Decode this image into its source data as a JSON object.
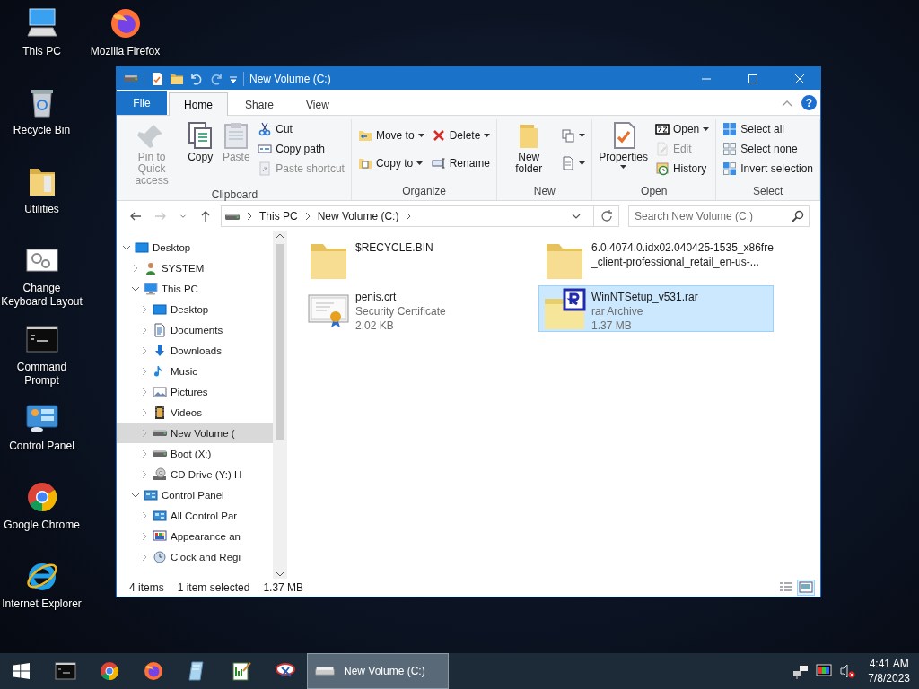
{
  "desktop_icons": [
    {
      "label": "This PC",
      "kind": "pc"
    },
    {
      "label": "Recycle Bin",
      "kind": "recycle"
    },
    {
      "label": "Utilities",
      "kind": "folder"
    },
    {
      "label": "Change Keyboard Layout",
      "kind": "keyboard"
    },
    {
      "label": "Command Prompt",
      "kind": "cmd"
    },
    {
      "label": "Control Panel",
      "kind": "control"
    },
    {
      "label": "Google Chrome",
      "kind": "chrome"
    },
    {
      "label": "Internet Explorer",
      "kind": "ie"
    },
    {
      "label": "Mozilla Firefox",
      "kind": "firefox"
    }
  ],
  "explorer": {
    "title": "New Volume (C:)",
    "tabs": [
      {
        "label": "File",
        "kind": "menu",
        "selected": false
      },
      {
        "label": "Home",
        "kind": "tab",
        "selected": true
      },
      {
        "label": "Share",
        "kind": "tab",
        "selected": false
      },
      {
        "label": "View",
        "kind": "tab",
        "selected": false
      }
    ],
    "help_button": "?",
    "ribbon_groups": [
      {
        "label": "Clipboard",
        "columns": [
          [
            {
              "label": "Pin to Quick access",
              "kind": "large",
              "disabled": true
            }
          ],
          [
            {
              "label": "Copy",
              "kind": "large",
              "disabled": false
            }
          ],
          [
            {
              "label": "Paste",
              "kind": "large",
              "disabled": true
            }
          ],
          [
            {
              "label": "Cut",
              "kind": "small",
              "disabled": false
            },
            {
              "label": "Copy path",
              "kind": "small",
              "disabled": false
            },
            {
              "label": "Paste shortcut",
              "kind": "small",
              "disabled": true
            }
          ]
        ]
      },
      {
        "label": "Organize",
        "columns": [
          [
            {
              "label": "Move to",
              "kind": "small",
              "disabled": false,
              "dropdown": true
            },
            {
              "label": "Copy to",
              "kind": "small",
              "disabled": false,
              "dropdown": true
            }
          ],
          [
            {
              "label": "Delete",
              "kind": "small",
              "disabled": false,
              "dropdown": true
            },
            {
              "label": "Rename",
              "kind": "small",
              "disabled": false
            }
          ]
        ]
      },
      {
        "label": "New",
        "columns": [
          [
            {
              "label": "New folder",
              "kind": "large",
              "disabled": false
            }
          ],
          [
            {
              "kind": "icon",
              "disabled": false,
              "dropdown": true
            },
            {
              "kind": "icon",
              "disabled": false,
              "dropdown": true
            }
          ]
        ]
      },
      {
        "label": "Open",
        "columns": [
          [
            {
              "label": "Properties",
              "kind": "large",
              "disabled": false,
              "dropdown": true
            }
          ],
          [
            {
              "label": "Open",
              "kind": "small",
              "disabled": false,
              "dropdown": true
            },
            {
              "label": "Edit",
              "kind": "small",
              "disabled": true
            },
            {
              "label": "History",
              "kind": "small",
              "disabled": false
            }
          ]
        ]
      },
      {
        "label": "Select",
        "columns": [
          [
            {
              "label": "Select all",
              "kind": "small",
              "disabled": false
            },
            {
              "label": "Select none",
              "kind": "small",
              "disabled": false
            },
            {
              "label": "Invert selection",
              "kind": "small",
              "disabled": false
            }
          ]
        ]
      }
    ],
    "nav_buttons": [
      {
        "kind": "back",
        "disabled": false
      },
      {
        "kind": "forward",
        "disabled": true
      },
      {
        "kind": "recent",
        "disabled": false
      },
      {
        "kind": "up",
        "disabled": false
      }
    ],
    "breadcrumbs": [
      "This PC",
      "New Volume (C:)"
    ],
    "search": {
      "placeholder": "Search New Volume (C:)"
    },
    "tree": [
      {
        "label": "Desktop",
        "kind": "desktop",
        "expanded": true,
        "selected": false,
        "children": [
          {
            "label": "SYSTEM",
            "kind": "user",
            "expanded": false,
            "selected": false
          },
          {
            "label": "This PC",
            "kind": "pc",
            "expanded": true,
            "selected": false,
            "children": [
              {
                "label": "Desktop",
                "kind": "desktop",
                "expanded": false,
                "selected": false
              },
              {
                "label": "Documents",
                "kind": "documents",
                "expanded": false,
                "selected": false
              },
              {
                "label": "Downloads",
                "kind": "downloads",
                "expanded": false,
                "selected": false
              },
              {
                "label": "Music",
                "kind": "music",
                "expanded": false,
                "selected": false
              },
              {
                "label": "Pictures",
                "kind": "pictures",
                "expanded": false,
                "selected": false
              },
              {
                "label": "Videos",
                "kind": "videos",
                "expanded": false,
                "selected": false
              },
              {
                "label": "New Volume (",
                "kind": "drive",
                "expanded": false,
                "selected": true
              },
              {
                "label": "Boot (X:)",
                "kind": "drive",
                "expanded": false,
                "selected": false
              },
              {
                "label": "CD Drive (Y:) H",
                "kind": "cd",
                "expanded": false,
                "selected": false
              }
            ]
          },
          {
            "label": "Control Panel",
            "kind": "control",
            "expanded": true,
            "selected": false,
            "children": [
              {
                "label": "All Control Par",
                "kind": "control",
                "expanded": false,
                "selected": false
              },
              {
                "label": "Appearance an",
                "kind": "appearance",
                "expanded": false,
                "selected": false
              },
              {
                "label": "Clock and Regi",
                "kind": "clock",
                "expanded": false,
                "selected": false
              }
            ]
          }
        ]
      }
    ],
    "files": [
      {
        "name": "$RECYCLE.BIN",
        "kind": "folder",
        "selected": false
      },
      {
        "name": "6.0.4074.0.idx02.040425-1535_x86fre_client-professional_retail_en-us-...",
        "kind": "folder",
        "selected": false
      },
      {
        "name": "penis.crt",
        "kind": "certificate",
        "type": "Security Certificate",
        "size": "2.02 KB",
        "selected": false
      },
      {
        "name": "WinNTSetup_v531.rar",
        "kind": "archive",
        "type": "rar Archive",
        "size": "1.37 MB",
        "selected": true
      }
    ],
    "status": {
      "item_count": "4 items",
      "selection": "1 item selected",
      "selection_size": "1.37 MB",
      "views": [
        {
          "kind": "details",
          "selected": false
        },
        {
          "kind": "large_icons",
          "selected": true
        }
      ]
    }
  },
  "taskbar": {
    "buttons": [
      {
        "kind": "cmd",
        "selected": false
      },
      {
        "kind": "chrome",
        "selected": false
      },
      {
        "kind": "firefox",
        "selected": false
      },
      {
        "kind": "notepad",
        "selected": false
      },
      {
        "kind": "editor",
        "selected": false
      },
      {
        "kind": "tool",
        "selected": false
      },
      {
        "kind": "explorer",
        "label": "New Volume (C:)",
        "selected": true
      }
    ],
    "time": "4:41 AM",
    "date": "7/8/2023"
  }
}
